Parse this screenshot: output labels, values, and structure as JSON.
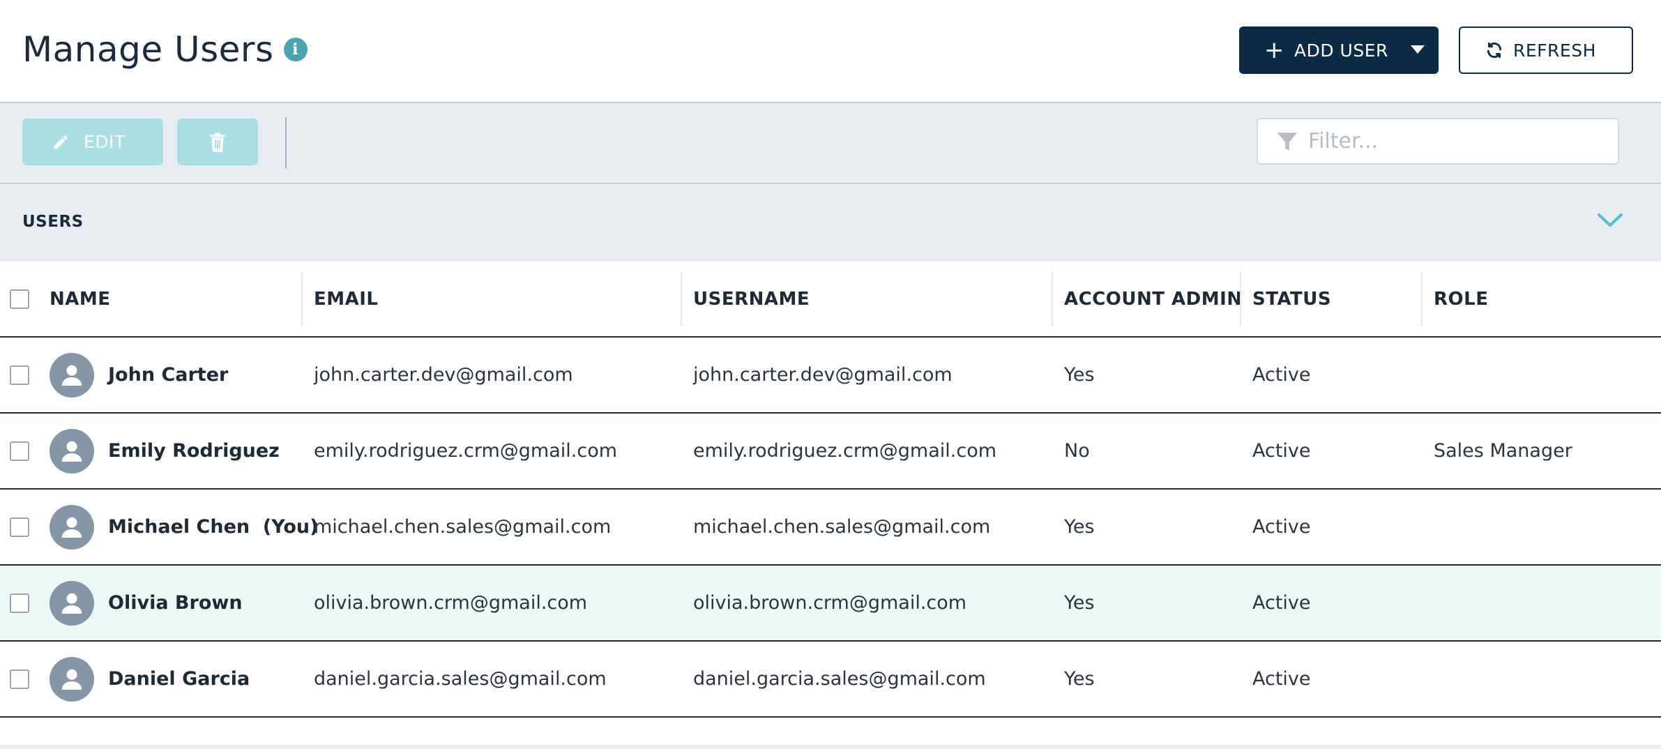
{
  "header": {
    "title": "Manage Users",
    "add_user_label": "ADD USER",
    "refresh_label": "REFRESH"
  },
  "toolbar": {
    "edit_label": "EDIT",
    "filter_placeholder": "Filter..."
  },
  "section": {
    "title": "USERS"
  },
  "table": {
    "columns": [
      "NAME",
      "EMAIL",
      "USERNAME",
      "ACCOUNT ADMIN",
      "STATUS",
      "ROLE"
    ],
    "rows": [
      {
        "name": "John Carter",
        "email": "john.carter.dev@gmail.com",
        "username": "john.carter.dev@gmail.com",
        "admin": "Yes",
        "status": "Active",
        "role": ""
      },
      {
        "name": "Emily Rodriguez",
        "email": "emily.rodriguez.crm@gmail.com",
        "username": "emily.rodriguez.crm@gmail.com",
        "admin": "No",
        "status": "Active",
        "role": "Sales Manager"
      },
      {
        "name": "Michael Chen  (You)",
        "email": "michael.chen.sales@gmail.com",
        "username": "michael.chen.sales@gmail.com",
        "admin": "Yes",
        "status": "Active",
        "role": ""
      },
      {
        "name": "Olivia Brown",
        "email": "olivia.brown.crm@gmail.com",
        "username": "olivia.brown.crm@gmail.com",
        "admin": "Yes",
        "status": "Active",
        "role": ""
      },
      {
        "name": "Daniel Garcia",
        "email": "daniel.garcia.sales@gmail.com",
        "username": "daniel.garcia.sales@gmail.com",
        "admin": "Yes",
        "status": "Active",
        "role": ""
      }
    ]
  },
  "colors": {
    "primary": "#0e2a45",
    "accent": "#4aa3b0",
    "disabled_button": "#a9dfe3",
    "toolbar_bg": "#e9ecf1",
    "highlight_row": "#eff6f6",
    "avatar": "#8696a7"
  },
  "icons": {
    "info": "info-icon",
    "add": "plus-icon",
    "dropdown": "caret-down-icon",
    "refresh": "refresh-icon",
    "edit": "pencil-icon",
    "delete": "trash-icon",
    "filter": "filter-icon",
    "collapse": "chevron-down-icon",
    "avatar": "user-icon"
  }
}
